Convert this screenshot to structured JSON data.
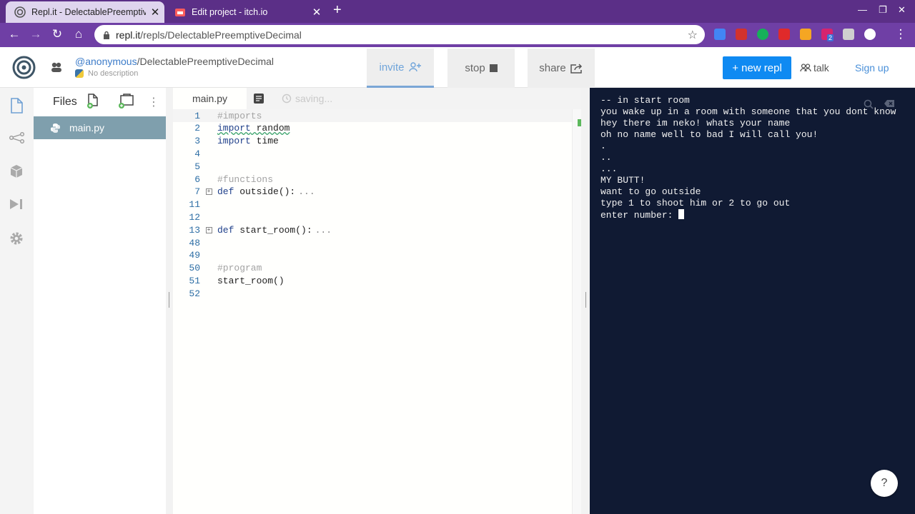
{
  "browser": {
    "tabs": [
      {
        "title": "Repl.it - DelectablePreemptiveDe",
        "active": true
      },
      {
        "title": "Edit project - itch.io",
        "active": false
      }
    ],
    "close_glyph": "✕",
    "new_tab_glyph": "+",
    "window_controls": {
      "minimize": "—",
      "restore": "❐",
      "close": "✕"
    },
    "url_host": "repl.it",
    "url_path": "/repls/DelectablePreemptiveDecimal",
    "nav": {
      "back": "←",
      "forward": "→",
      "reload": "↻",
      "home": "⌂"
    },
    "star_glyph": "☆",
    "menu_glyph": "⋮",
    "extensions": [
      "#4285f4",
      "#d2322d",
      "#16b05a",
      "#e02a2a",
      "#f5a623",
      "#d6246e",
      "#cfcfcf",
      "#ffffff"
    ],
    "extension_badge": "2"
  },
  "header": {
    "owner": "@anonymous",
    "separator": "/",
    "repl_name": "DelectablePreemptiveDecimal",
    "description": "No description",
    "invite_label": "invite",
    "stop_label": "stop",
    "share_label": "share",
    "new_repl_label": "+ new repl",
    "talk_label": "talk",
    "signup_label": "Sign up"
  },
  "rail": {
    "icons": [
      "files-icon",
      "version-control-icon",
      "packages-icon",
      "debugger-icon",
      "settings-icon"
    ]
  },
  "files_panel": {
    "title": "Files",
    "menu_glyph": "⋮",
    "files": [
      {
        "name": "main.py",
        "selected": true
      }
    ]
  },
  "editor": {
    "tab_label": "main.py",
    "status_label": "saving...",
    "fold_glyph": "+",
    "fold_ellipsis": "...",
    "lines": [
      {
        "num": "1",
        "text": "#imports",
        "type": "comment",
        "current": true
      },
      {
        "num": "2",
        "kw": "import",
        "rest": " random",
        "squiggle": true
      },
      {
        "num": "3",
        "kw": "import",
        "rest": " time"
      },
      {
        "num": "4",
        "text": ""
      },
      {
        "num": "5",
        "text": ""
      },
      {
        "num": "6",
        "text": "#functions",
        "type": "comment"
      },
      {
        "num": "7",
        "kw": "def",
        "rest": " outside():",
        "folded": true
      },
      {
        "num": "11",
        "text": ""
      },
      {
        "num": "12",
        "text": ""
      },
      {
        "num": "13",
        "kw": "def",
        "rest": " start_room():",
        "folded": true
      },
      {
        "num": "48",
        "text": ""
      },
      {
        "num": "49",
        "text": ""
      },
      {
        "num": "50",
        "text": "#program",
        "type": "comment"
      },
      {
        "num": "51",
        "text": "start_room()"
      },
      {
        "num": "52",
        "text": ""
      }
    ]
  },
  "console": {
    "lines": [
      "-- in start room",
      "you wake up in a room with someone that you dont know",
      "hey there im neko! whats your name",
      "oh no name well to bad I will call you!",
      ".",
      "..",
      "...",
      "MY BUTT!",
      "want to go outside",
      "type 1 to shoot him or 2 to go out",
      "enter number: "
    ],
    "help_label": "?"
  },
  "colors": {
    "tabstrip": "#5b2f87",
    "toolbar": "#6f3fa5",
    "accent": "#0f8af2",
    "console_bg": "#101a33",
    "file_selected": "#7f9fad"
  }
}
